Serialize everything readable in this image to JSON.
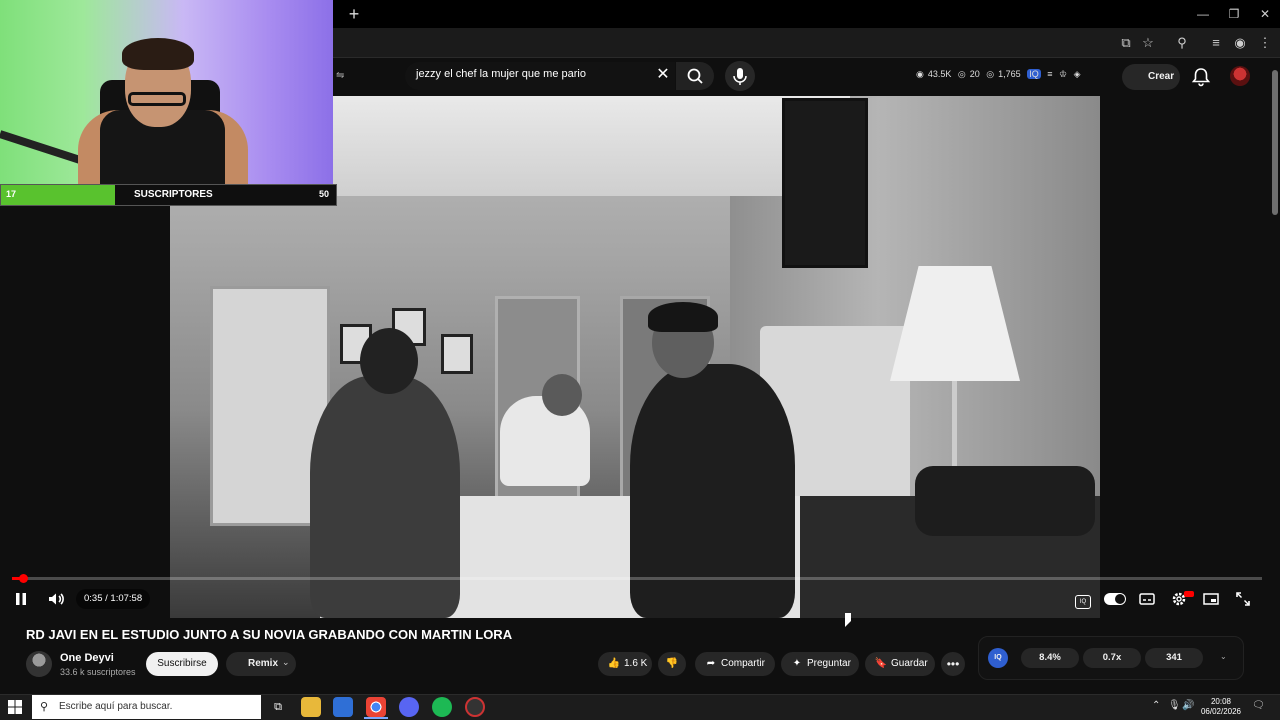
{
  "browser": {
    "new_tab_symbol": "+",
    "window_controls": [
      "—",
      "❐",
      "✕"
    ]
  },
  "masthead": {
    "search_query": "jezzy el chef la mujer que me pario",
    "stats": [
      "43.5K",
      "20",
      "1,765"
    ],
    "create_label": "Crear"
  },
  "stream_overlay": {
    "sub_goal_left": "17",
    "sub_goal_label": "SUSCRIPTORES",
    "sub_goal_right": "50",
    "sub_goal_progress": 0.34
  },
  "player": {
    "time_display": "0:35 / 1:07:58",
    "progress_fraction": 0.009
  },
  "video": {
    "title": "RD JAVI EN EL ESTUDIO JUNTO A SU NOVIA GRABANDO CON MARTIN LORA",
    "channel_name": "One Deyvi",
    "channel_subs": "33.6 k suscriptores",
    "subscribe_label": "Suscribirse",
    "remix_label": "Remix",
    "likes": "1.6 K",
    "share_label": "Compartir",
    "ask_label": "Preguntar",
    "save_label": "Guardar"
  },
  "iq_panel": {
    "logo": "IQ",
    "values": [
      "8.4%",
      "0.7x",
      "341"
    ]
  },
  "taskbar": {
    "search_placeholder": "Escribe aquí para buscar.",
    "time": "20:08",
    "date": "06/02/2026"
  },
  "colors": {
    "accent_red": "#ff0000",
    "sub_goal_green": "#59c22e",
    "iq_blue": "#2f5fd0"
  }
}
